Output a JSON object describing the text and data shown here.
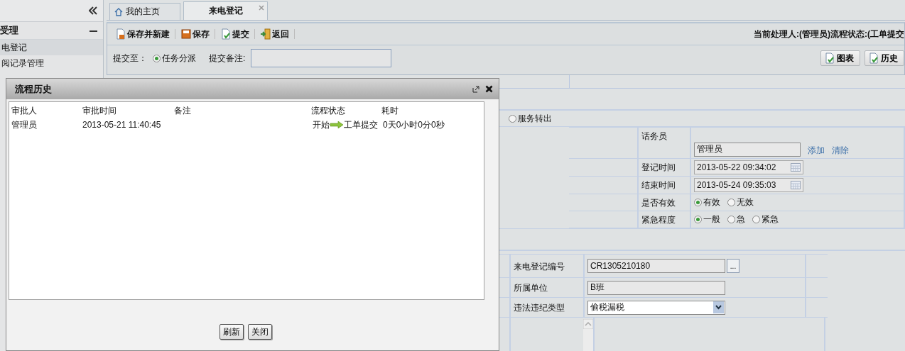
{
  "sidebar": {
    "section": {
      "title": "受理",
      "expanded": true
    },
    "items": [
      {
        "label": "电登记",
        "selected": true
      },
      {
        "label": "阅记录管理",
        "selected": false
      }
    ]
  },
  "tabs": [
    {
      "label": "我的主页",
      "selected": false,
      "closable": false
    },
    {
      "label": "来电登记",
      "selected": true,
      "closable": true
    }
  ],
  "toolbar": {
    "buttons": [
      "保存并新建",
      "保存",
      "提交",
      "返回"
    ],
    "status": "当前处理人:(管理员)流程状态:(工单提交"
  },
  "submit": {
    "label": "提交至：",
    "options": [
      {
        "label": "任务分派",
        "selected": true
      }
    ],
    "remark_label": "提交备注:"
  },
  "side_buttons": [
    "图表",
    "历史"
  ],
  "route_options": [
    {
      "label": "服务转出",
      "selected": false
    }
  ],
  "fields": [
    {
      "kind": "text",
      "label": "话务员",
      "value": "管理员",
      "links": [
        "添加",
        "清除"
      ]
    },
    {
      "kind": "date",
      "label": "登记时间",
      "value": "2013-05-22 09:34:02"
    },
    {
      "kind": "date",
      "label": "结束时间",
      "value": "2013-05-24 09:35:03"
    },
    {
      "kind": "radio",
      "label": "是否有效",
      "options": [
        {
          "label": "有效",
          "selected": true
        },
        {
          "label": "无效",
          "selected": false
        }
      ]
    },
    {
      "kind": "radio",
      "label": "紧急程度",
      "options": [
        {
          "label": "一般",
          "selected": true
        },
        {
          "label": "急",
          "selected": false
        },
        {
          "label": "紧急",
          "selected": false
        }
      ]
    }
  ],
  "fields2": [
    {
      "kind": "lookup",
      "label": "来电登记编号",
      "value": "CR1305210180",
      "button": "..."
    },
    {
      "kind": "text",
      "label": "所属单位",
      "value": "B班"
    },
    {
      "kind": "select",
      "label": "违法违纪类型",
      "value": "偷税漏税"
    },
    {
      "kind": "textarea"
    }
  ],
  "dialog": {
    "title": "流程历史",
    "columns": [
      "审批人",
      "审批时间",
      "备注",
      "流程状态",
      "耗时"
    ],
    "rows": [
      {
        "approver": "管理员",
        "time": "2013-05-21 11:40:45",
        "from": "开始",
        "to": "工单提交",
        "duration": "0天0小时0分0秒"
      }
    ],
    "buttons": [
      "刷新",
      "关闭"
    ]
  }
}
